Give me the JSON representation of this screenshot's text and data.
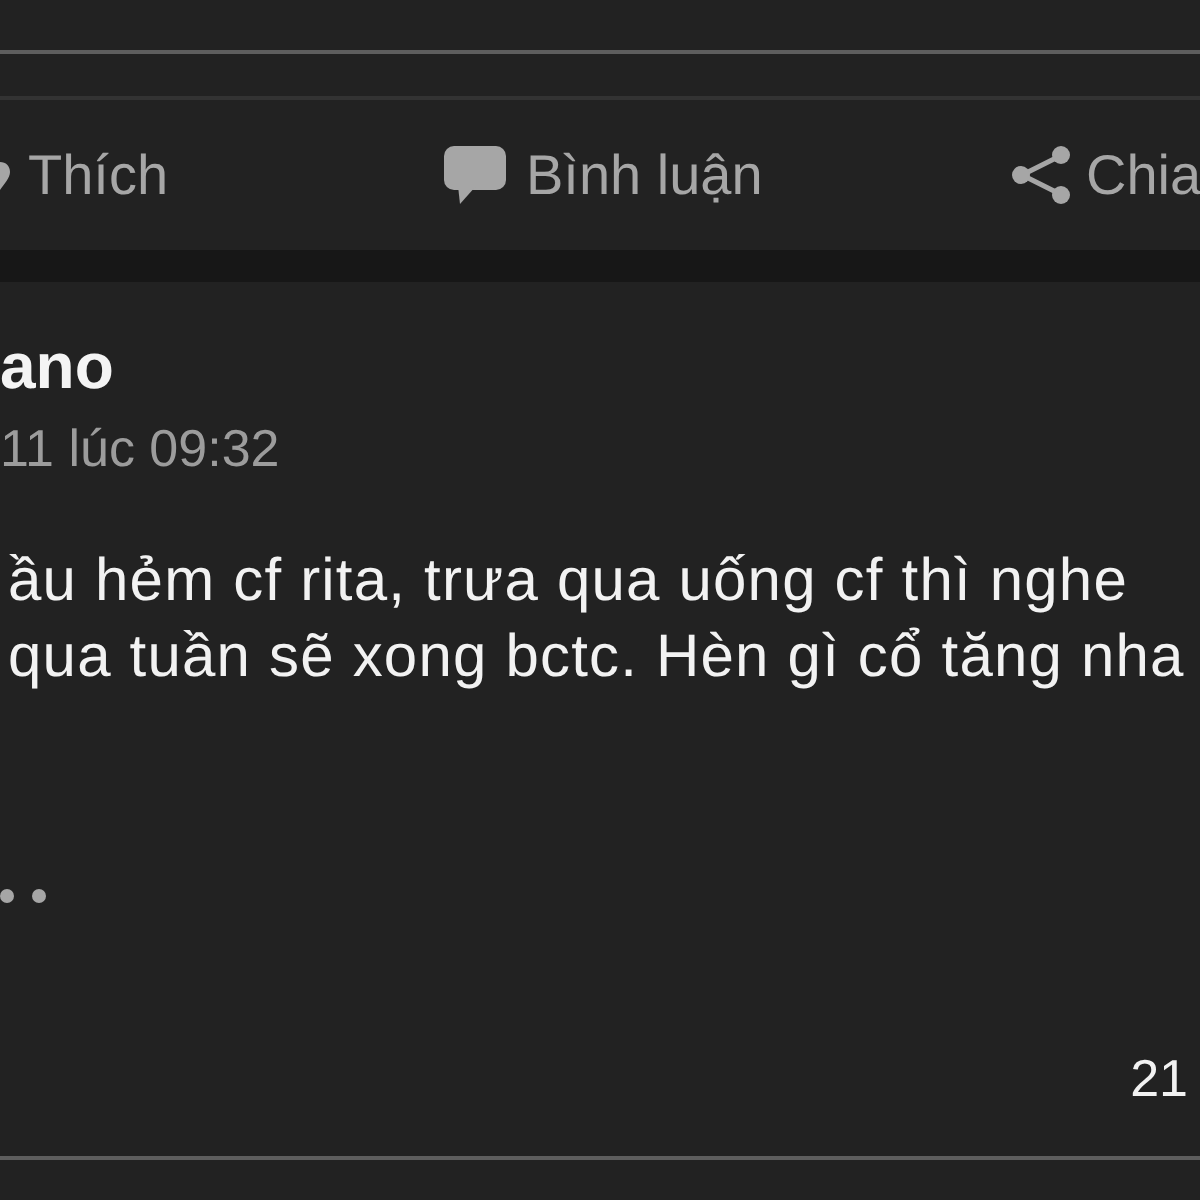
{
  "action_bar": {
    "actions": [
      {
        "kind": "like",
        "label": "Thích"
      },
      {
        "kind": "comment",
        "label": "Bình luận"
      },
      {
        "kind": "share",
        "label": "Chia"
      }
    ]
  },
  "post": {
    "author": "ano",
    "timestamp": "11 lúc 09:32",
    "text": "ầu hẻm cf rita, trưa qua uống cf thì nghe\nqua tuần sẽ xong bctc. Hèn gì cổ tăng nha",
    "count": "21"
  }
}
